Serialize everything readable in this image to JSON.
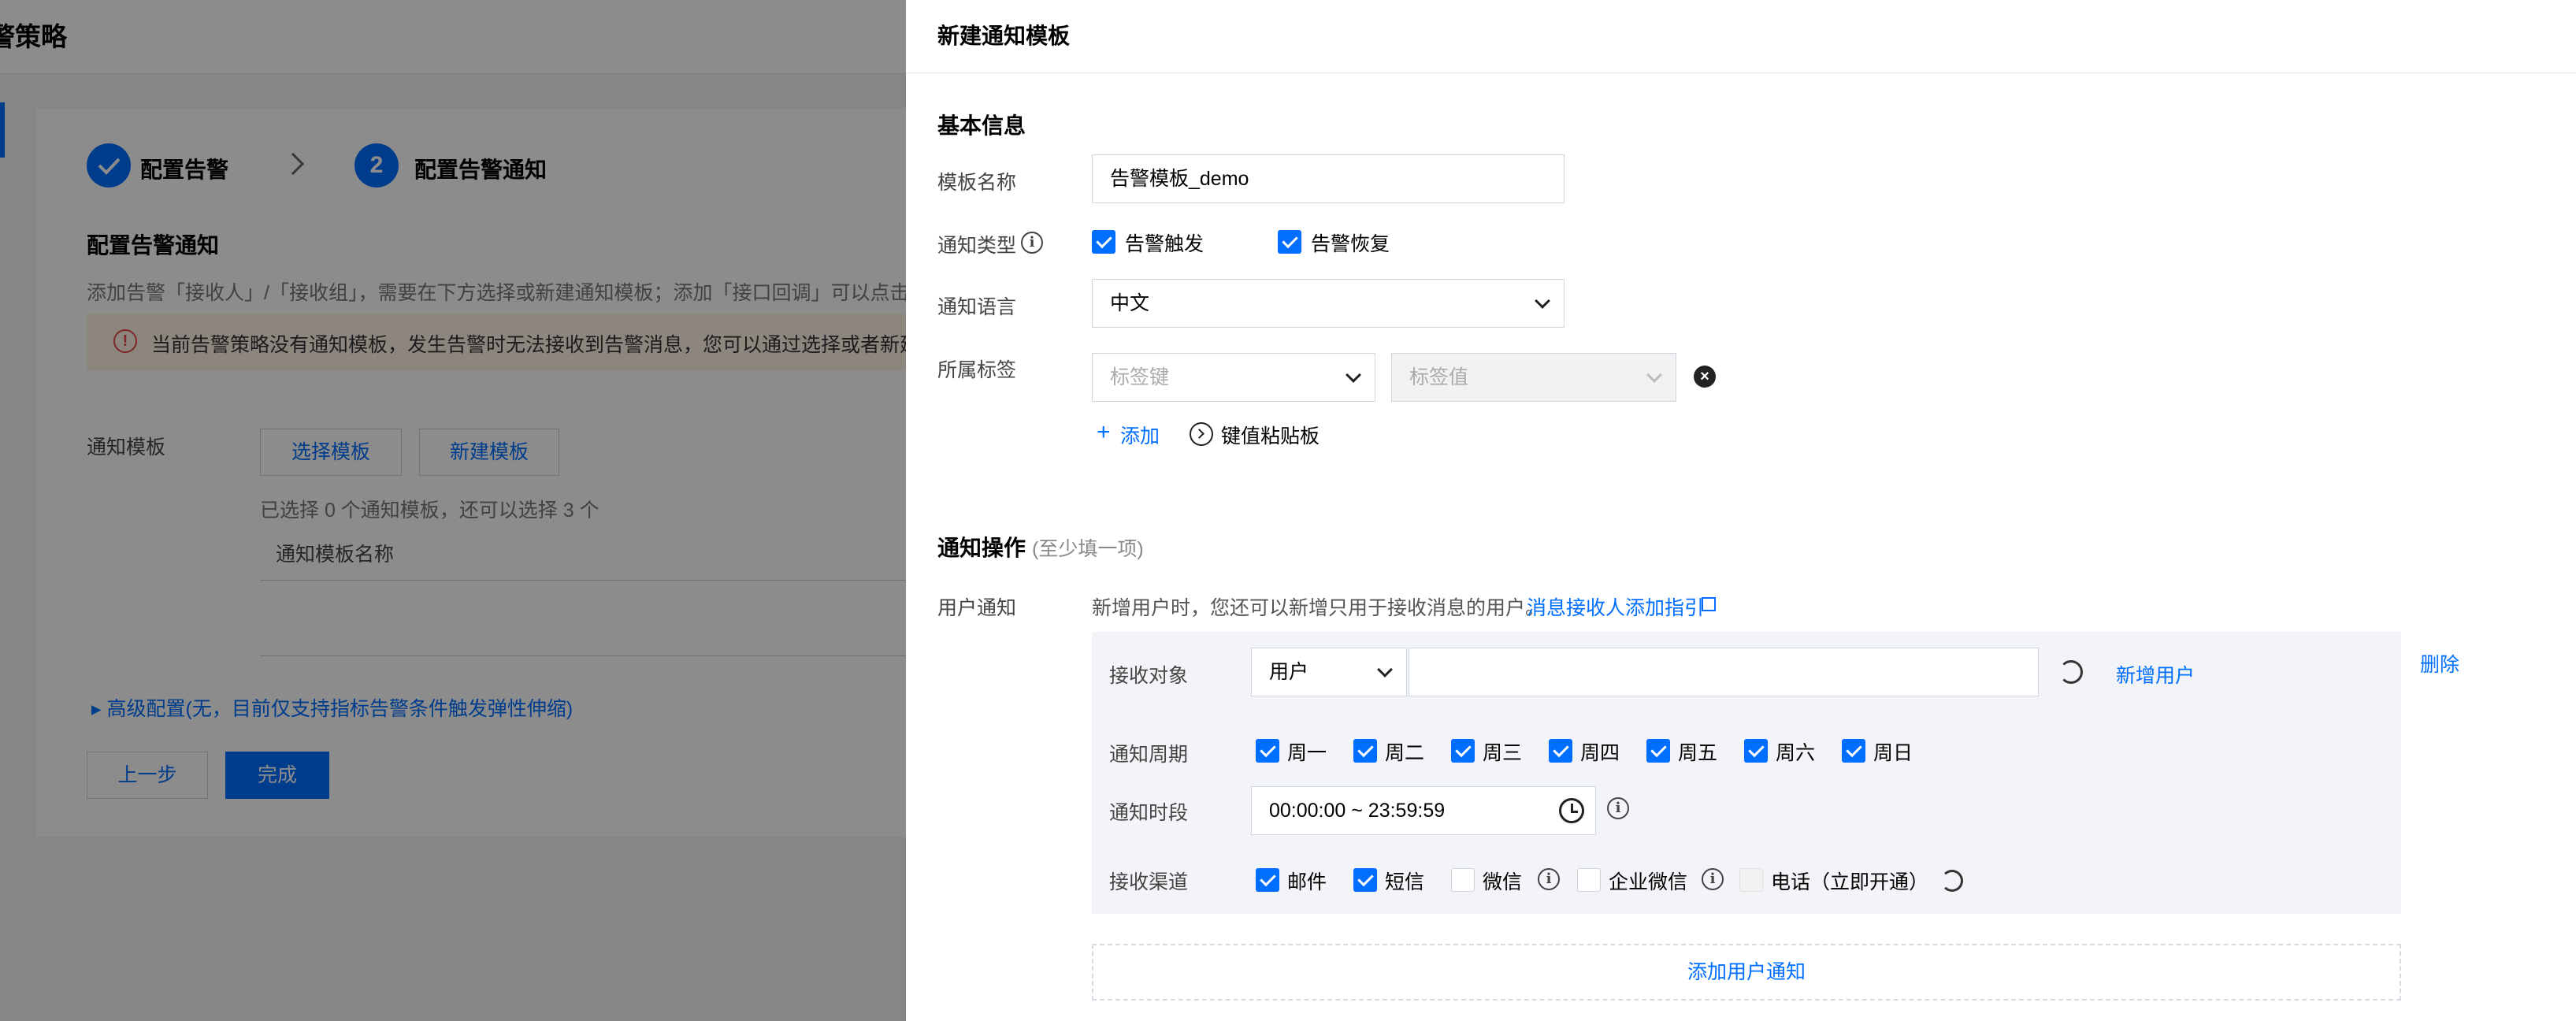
{
  "background": {
    "title": "警策略",
    "steps": [
      {
        "label": "配置告警",
        "number": ""
      },
      {
        "label": "配置告警通知",
        "number": "2"
      }
    ],
    "section_title": "配置告警通知",
    "hint": "添加告警「接收人」/「接收组」，需要在下方选择或新建通知模板；添加「接口回调」可以点击模板",
    "warning": "当前告警策略没有通知模板，发生告警时无法接收到告警消息，您可以通过选择或者新建通",
    "template_label": "通知模板",
    "select_template": "选择模板",
    "new_template": "新建模板",
    "selected_info": "已选择 0 个通知模板，还可以选择 3 个",
    "table_header": "通知模板名称",
    "advanced": "▸ 高级配置(无，目前仅支持指标告警条件触发弹性伸缩)",
    "prev": "上一步",
    "finish": "完成"
  },
  "drawer": {
    "title": "新建通知模板",
    "basic_section": "基本信息",
    "name_label": "模板名称",
    "name_value": "告警模板_demo",
    "type_label": "通知类型",
    "type_options": [
      {
        "label": "告警触发",
        "checked": true
      },
      {
        "label": "告警恢复",
        "checked": true
      }
    ],
    "lang_label": "通知语言",
    "lang_value": "中文",
    "tag_label": "所属标签",
    "tag_key_placeholder": "标签键",
    "tag_value_placeholder": "标签值",
    "add_label": "添加",
    "paste_label": "键值粘贴板",
    "ops_section": "通知操作",
    "ops_sub": "(至少填一项)",
    "user_notify_label": "用户通知",
    "user_notify_hint": "新增用户时，您还可以新增只用于接收消息的用户。",
    "user_notify_link": "消息接收人添加指引",
    "receiver_label": "接收对象",
    "receiver_type": "用户",
    "new_user": "新增用户",
    "delete": "删除",
    "period_label": "通知周期",
    "days": [
      "周一",
      "周二",
      "周三",
      "周四",
      "周五",
      "周六",
      "周日"
    ],
    "time_label": "通知时段",
    "time_value": "00:00:00 ~ 23:59:59",
    "channel_label": "接收渠道",
    "channels": [
      {
        "label": "邮件",
        "state": "checked"
      },
      {
        "label": "短信",
        "state": "checked"
      },
      {
        "label": "微信",
        "state": "unchecked"
      },
      {
        "label": "企业微信",
        "state": "unchecked"
      },
      {
        "label": "电话（立即开通）",
        "state": "disabled"
      }
    ],
    "add_user_notify": "添加用户通知"
  },
  "colors": {
    "accent": "#006eff",
    "overlay": "rgba(0,0,0,0.45)"
  },
  "icons": [
    "check-icon",
    "chevron-right-icon",
    "warning-icon",
    "info-icon",
    "chevron-down-icon",
    "close-circle-icon",
    "plus-icon",
    "chevron-circle-icon",
    "refresh-icon",
    "external-link-icon",
    "clock-icon"
  ]
}
